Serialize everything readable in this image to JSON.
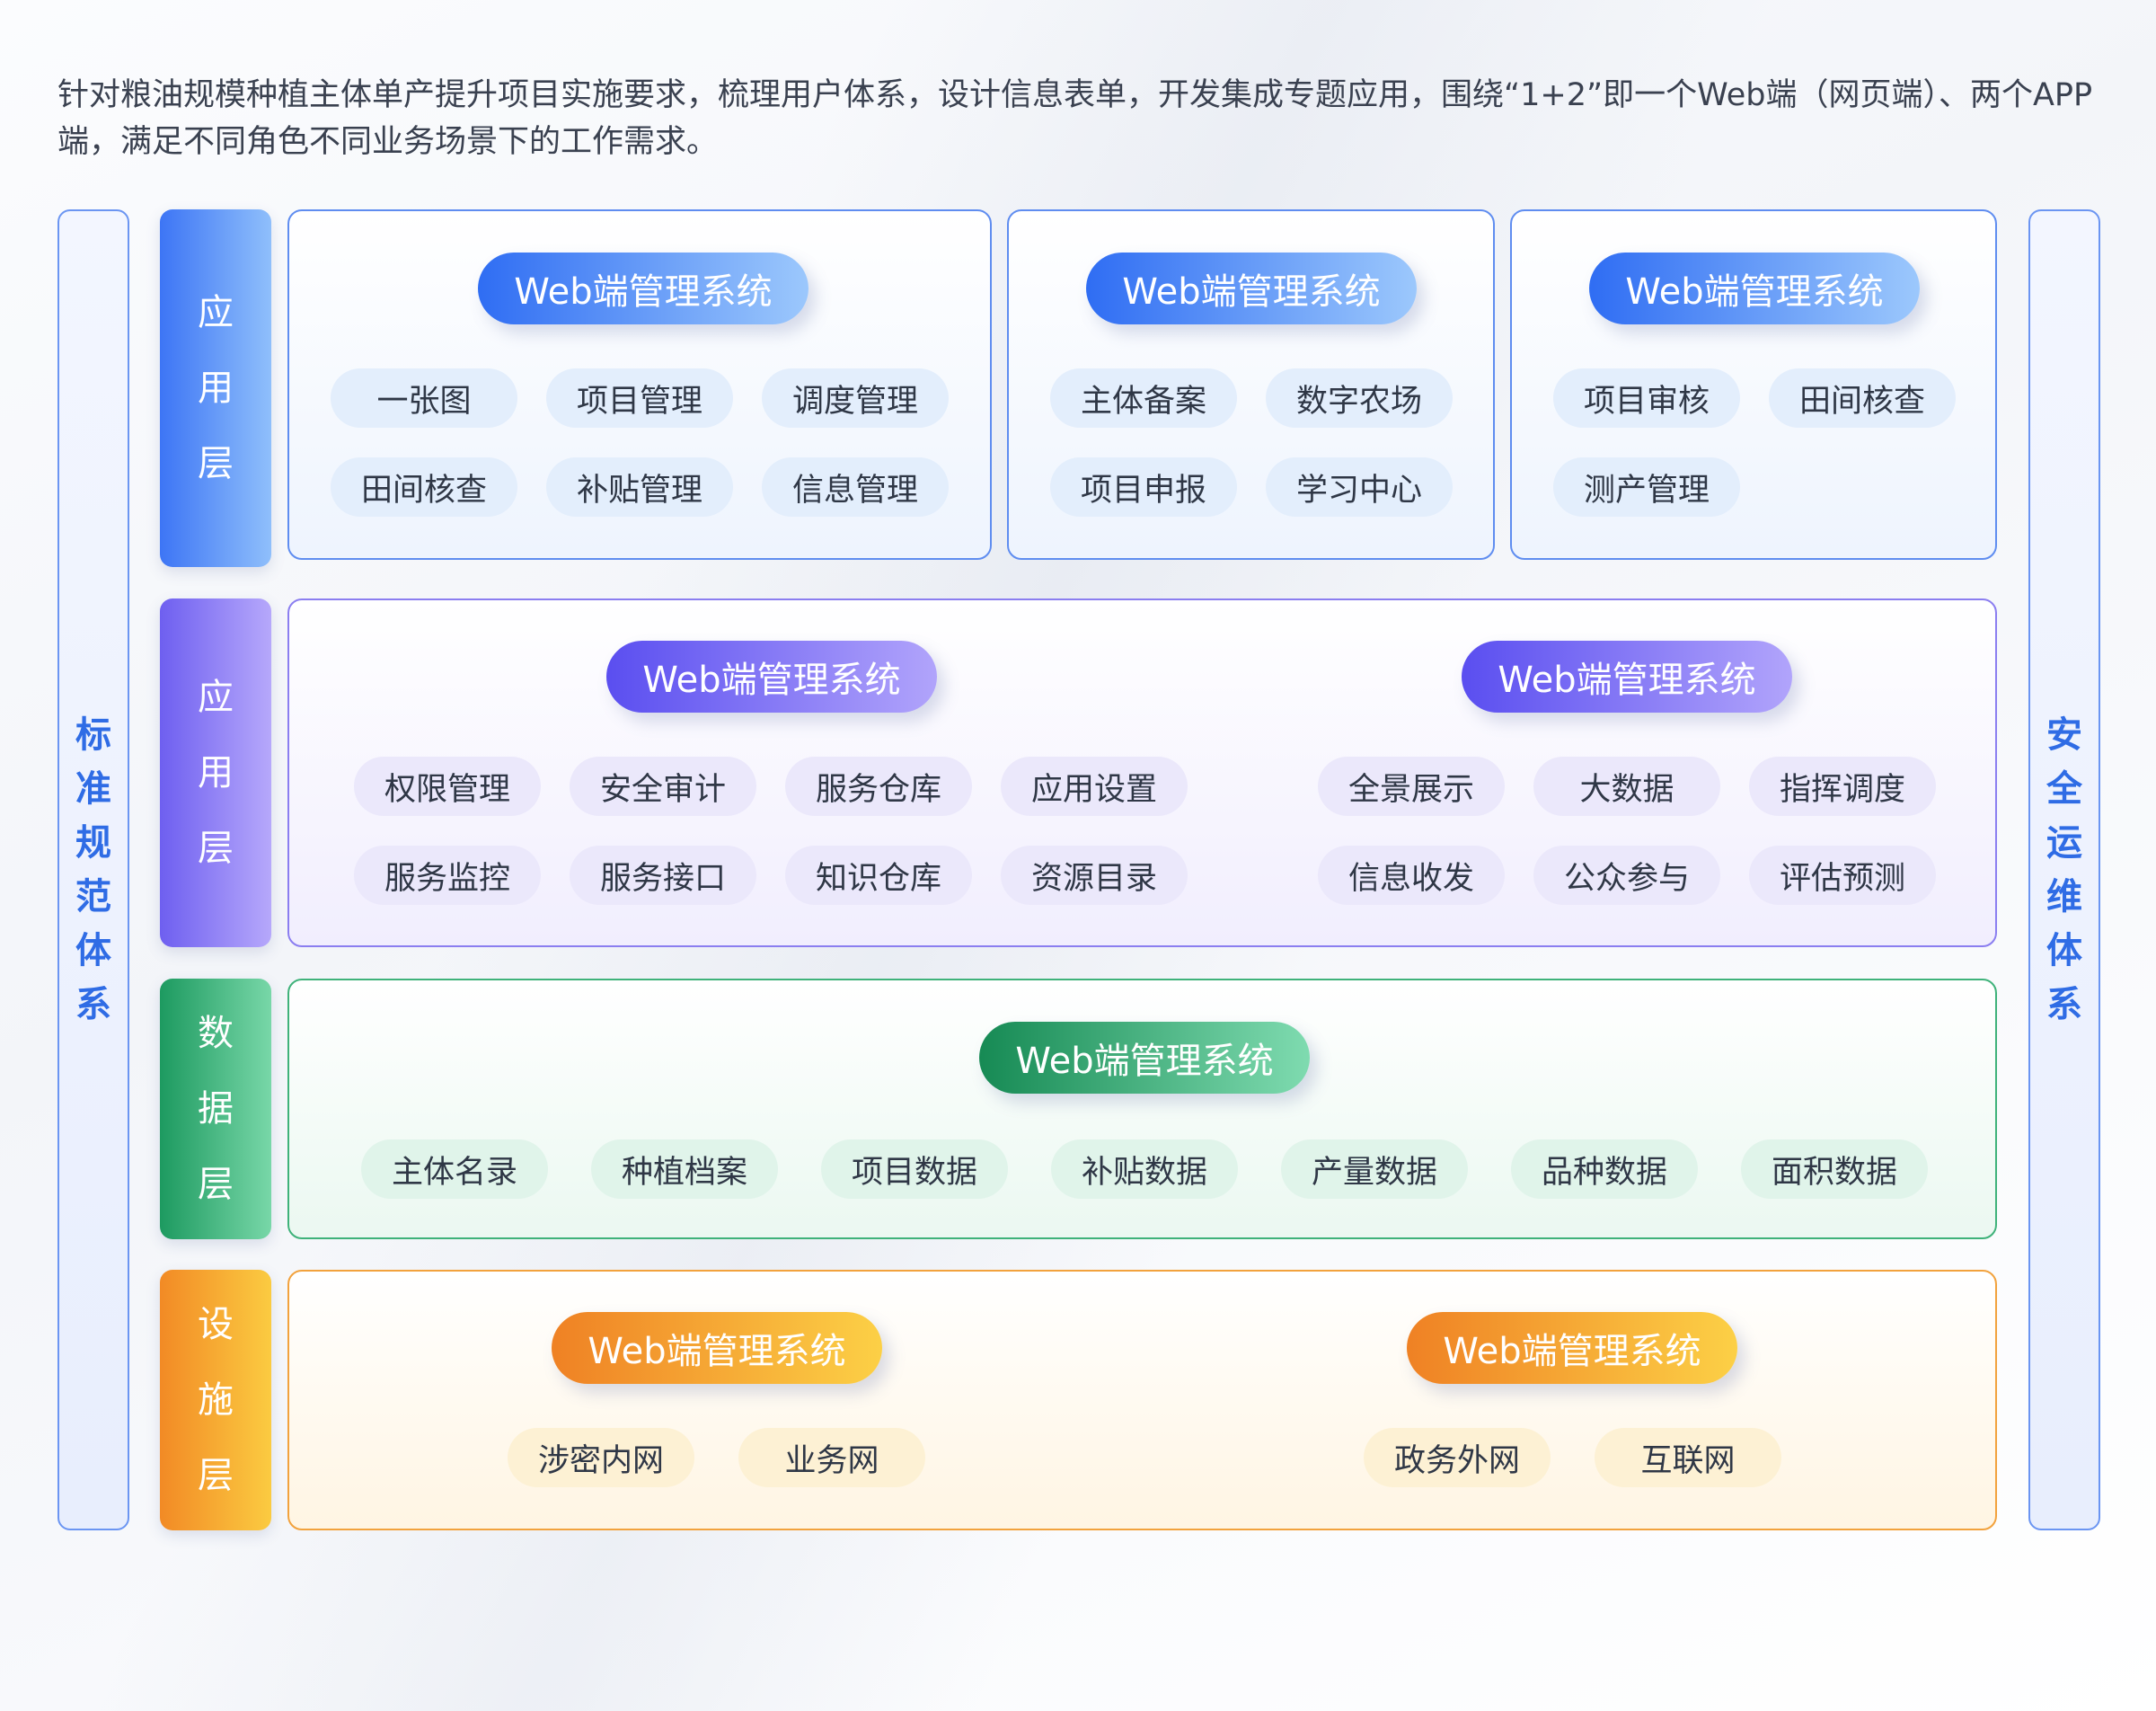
{
  "intro": "针对粮油规模种植主体单产提升项目实施要求，梳理用户体系，设计信息表单，开发集成专题应用，围绕“1+2”即一个Web端（网页端）、两个APP端，满足不同角色不同业务场景下的工作需求。",
  "left_system": [
    "标",
    "准",
    "规",
    "范",
    "体",
    "系"
  ],
  "right_system": [
    "安",
    "全",
    "运",
    "维",
    "体",
    "系"
  ],
  "layers": {
    "app": {
      "label": [
        "应",
        "用",
        "层"
      ],
      "panels": [
        {
          "title": "Web端管理系统",
          "items": [
            "一张图",
            "项目管理",
            "调度管理",
            "田间核查",
            "补贴管理",
            "信息管理"
          ]
        },
        {
          "title": "Web端管理系统",
          "items": [
            "主体备案",
            "数字农场",
            "项目申报",
            "学习中心"
          ]
        },
        {
          "title": "Web端管理系统",
          "items": [
            "项目审核",
            "田间核查",
            "测产管理"
          ]
        }
      ]
    },
    "app2": {
      "label": [
        "应",
        "用",
        "层"
      ],
      "panels": [
        {
          "title": "Web端管理系统",
          "items": [
            "权限管理",
            "安全审计",
            "服务仓库",
            "应用设置",
            "服务监控",
            "服务接口",
            "知识仓库",
            "资源目录"
          ]
        },
        {
          "title": "Web端管理系统",
          "items": [
            "全景展示",
            "大数据",
            "指挥调度",
            "信息收发",
            "公众参与",
            "评估预测"
          ]
        }
      ]
    },
    "data": {
      "label": [
        "数",
        "据",
        "层"
      ],
      "panels": [
        {
          "title": "Web端管理系统",
          "items": [
            "主体名录",
            "种植档案",
            "项目数据",
            "补贴数据",
            "产量数据",
            "品种数据",
            "面积数据"
          ]
        }
      ]
    },
    "infra": {
      "label": [
        "设",
        "施",
        "层"
      ],
      "panels": [
        {
          "title": "Web端管理系统",
          "items": [
            "涉密内网",
            "业务网"
          ]
        },
        {
          "title": "Web端管理系统",
          "items": [
            "政务外网",
            "互联网"
          ]
        }
      ]
    }
  },
  "colors": {
    "blue": "#3d75f5",
    "purple": "#6e5ff0",
    "green": "#1d9a60",
    "orange": "#f28a25",
    "side_text": "#2f6ce5"
  }
}
